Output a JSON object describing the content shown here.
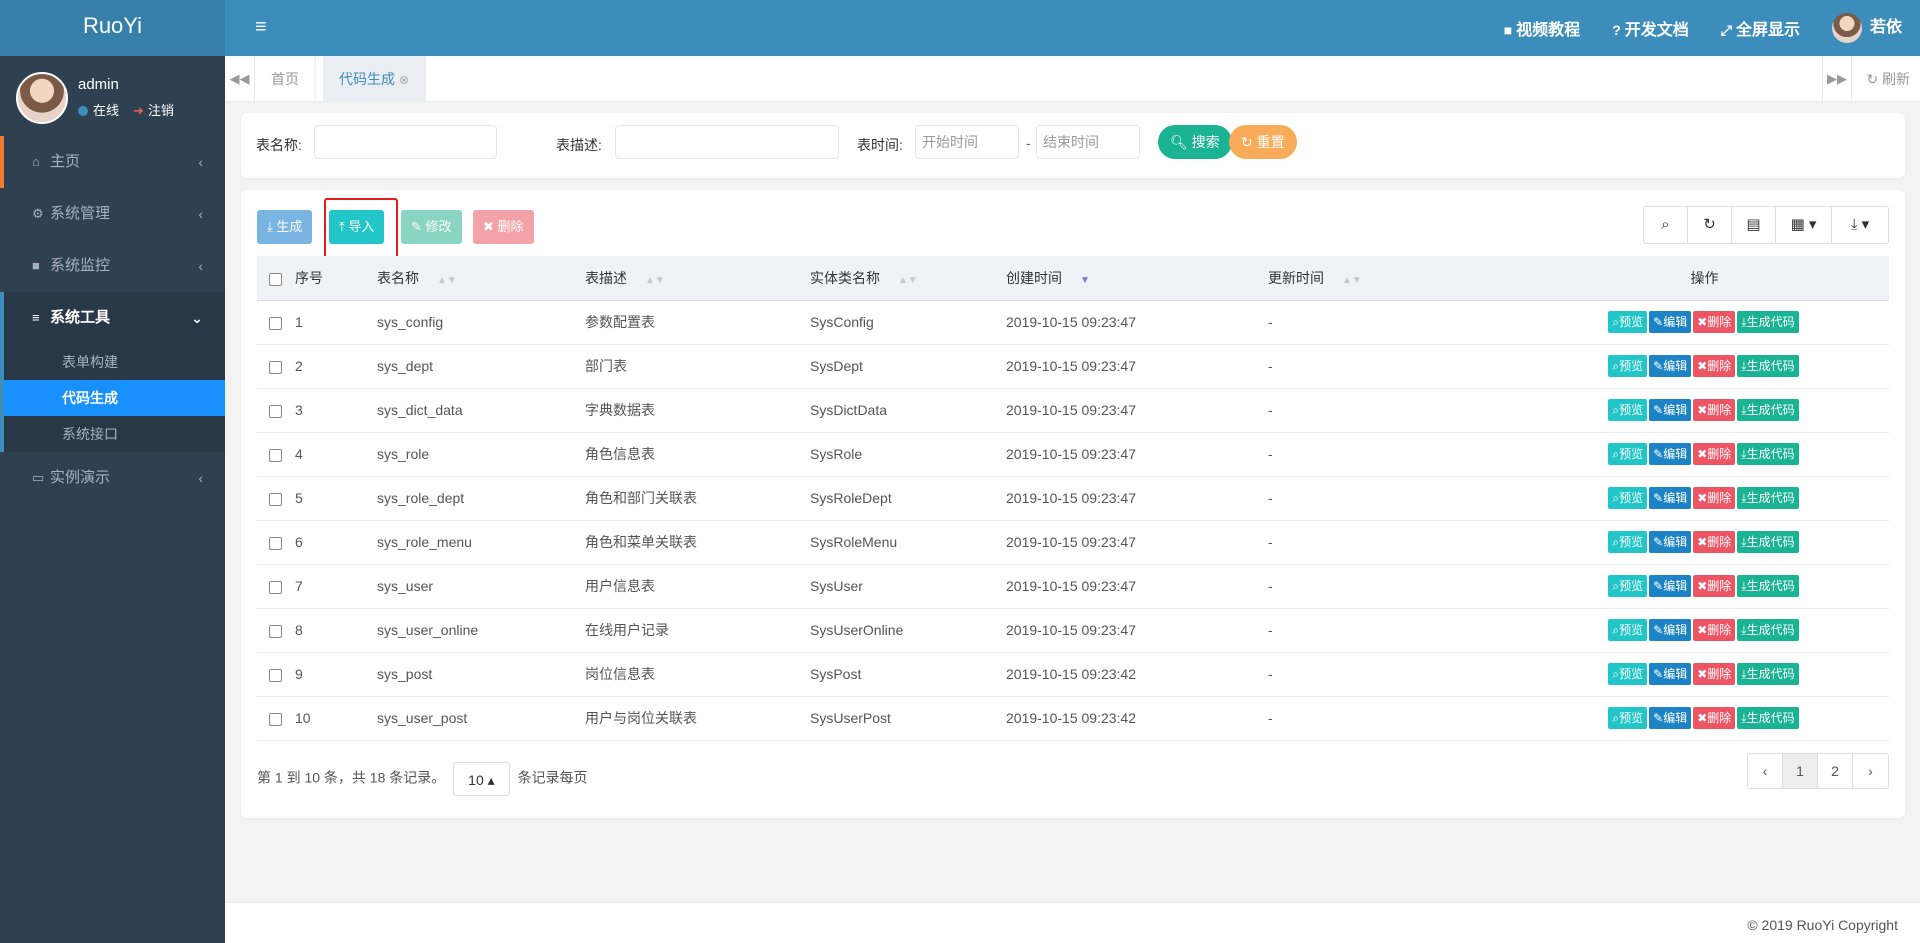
{
  "app": {
    "logo": "RuoYi"
  },
  "user": {
    "name": "admin",
    "status": "在线",
    "logout": "注销"
  },
  "sidebar": {
    "items": [
      {
        "icon": "home-icon",
        "label": "主页"
      },
      {
        "icon": "gear-icon",
        "label": "系统管理"
      },
      {
        "icon": "video-icon",
        "label": "系统监控"
      },
      {
        "icon": "bars-icon",
        "label": "系统工具"
      },
      {
        "icon": "desktop-icon",
        "label": "实例演示"
      }
    ],
    "submenu": [
      "表单构建",
      "代码生成",
      "系统接口"
    ]
  },
  "header": {
    "links": [
      "视频教程",
      "开发文档",
      "全屏显示"
    ],
    "user_name": "若依"
  },
  "tabs": {
    "items": [
      "首页",
      "代码生成"
    ],
    "refresh": "刷新"
  },
  "search": {
    "table_name_label": "表名称:",
    "table_desc_label": "表描述:",
    "time_label": "表时间:",
    "start_placeholder": "开始时间",
    "end_placeholder": "结束时间",
    "dash": "-",
    "search_btn": "搜索",
    "reset_btn": "重置"
  },
  "toolbar": {
    "generate": "生成",
    "import": "导入",
    "modify": "修改",
    "delete": "删除"
  },
  "table": {
    "headers": [
      "序号",
      "表名称",
      "表描述",
      "实体类名称",
      "创建时间",
      "更新时间",
      "操作"
    ],
    "actions": {
      "preview": "预览",
      "edit": "编辑",
      "delete": "删除",
      "gen": "生成代码"
    },
    "rows": [
      [
        "1",
        "sys_config",
        "参数配置表",
        "SysConfig",
        "2019-10-15 09:23:47",
        "-"
      ],
      [
        "2",
        "sys_dept",
        "部门表",
        "SysDept",
        "2019-10-15 09:23:47",
        "-"
      ],
      [
        "3",
        "sys_dict_data",
        "字典数据表",
        "SysDictData",
        "2019-10-15 09:23:47",
        "-"
      ],
      [
        "4",
        "sys_role",
        "角色信息表",
        "SysRole",
        "2019-10-15 09:23:47",
        "-"
      ],
      [
        "5",
        "sys_role_dept",
        "角色和部门关联表",
        "SysRoleDept",
        "2019-10-15 09:23:47",
        "-"
      ],
      [
        "6",
        "sys_role_menu",
        "角色和菜单关联表",
        "SysRoleMenu",
        "2019-10-15 09:23:47",
        "-"
      ],
      [
        "7",
        "sys_user",
        "用户信息表",
        "SysUser",
        "2019-10-15 09:23:47",
        "-"
      ],
      [
        "8",
        "sys_user_online",
        "在线用户记录",
        "SysUserOnline",
        "2019-10-15 09:23:47",
        "-"
      ],
      [
        "9",
        "sys_post",
        "岗位信息表",
        "SysPost",
        "2019-10-15 09:23:42",
        "-"
      ],
      [
        "10",
        "sys_user_post",
        "用户与岗位关联表",
        "SysUserPost",
        "2019-10-15 09:23:42",
        "-"
      ]
    ]
  },
  "pager": {
    "info": "第 1 到 10 条，共 18 条记录。",
    "page_size": "10",
    "per_page": "条记录每页",
    "pages": [
      "‹",
      "1",
      "2",
      "›"
    ]
  },
  "footer": {
    "copyright": "© 2019 RuoYi Copyright"
  }
}
